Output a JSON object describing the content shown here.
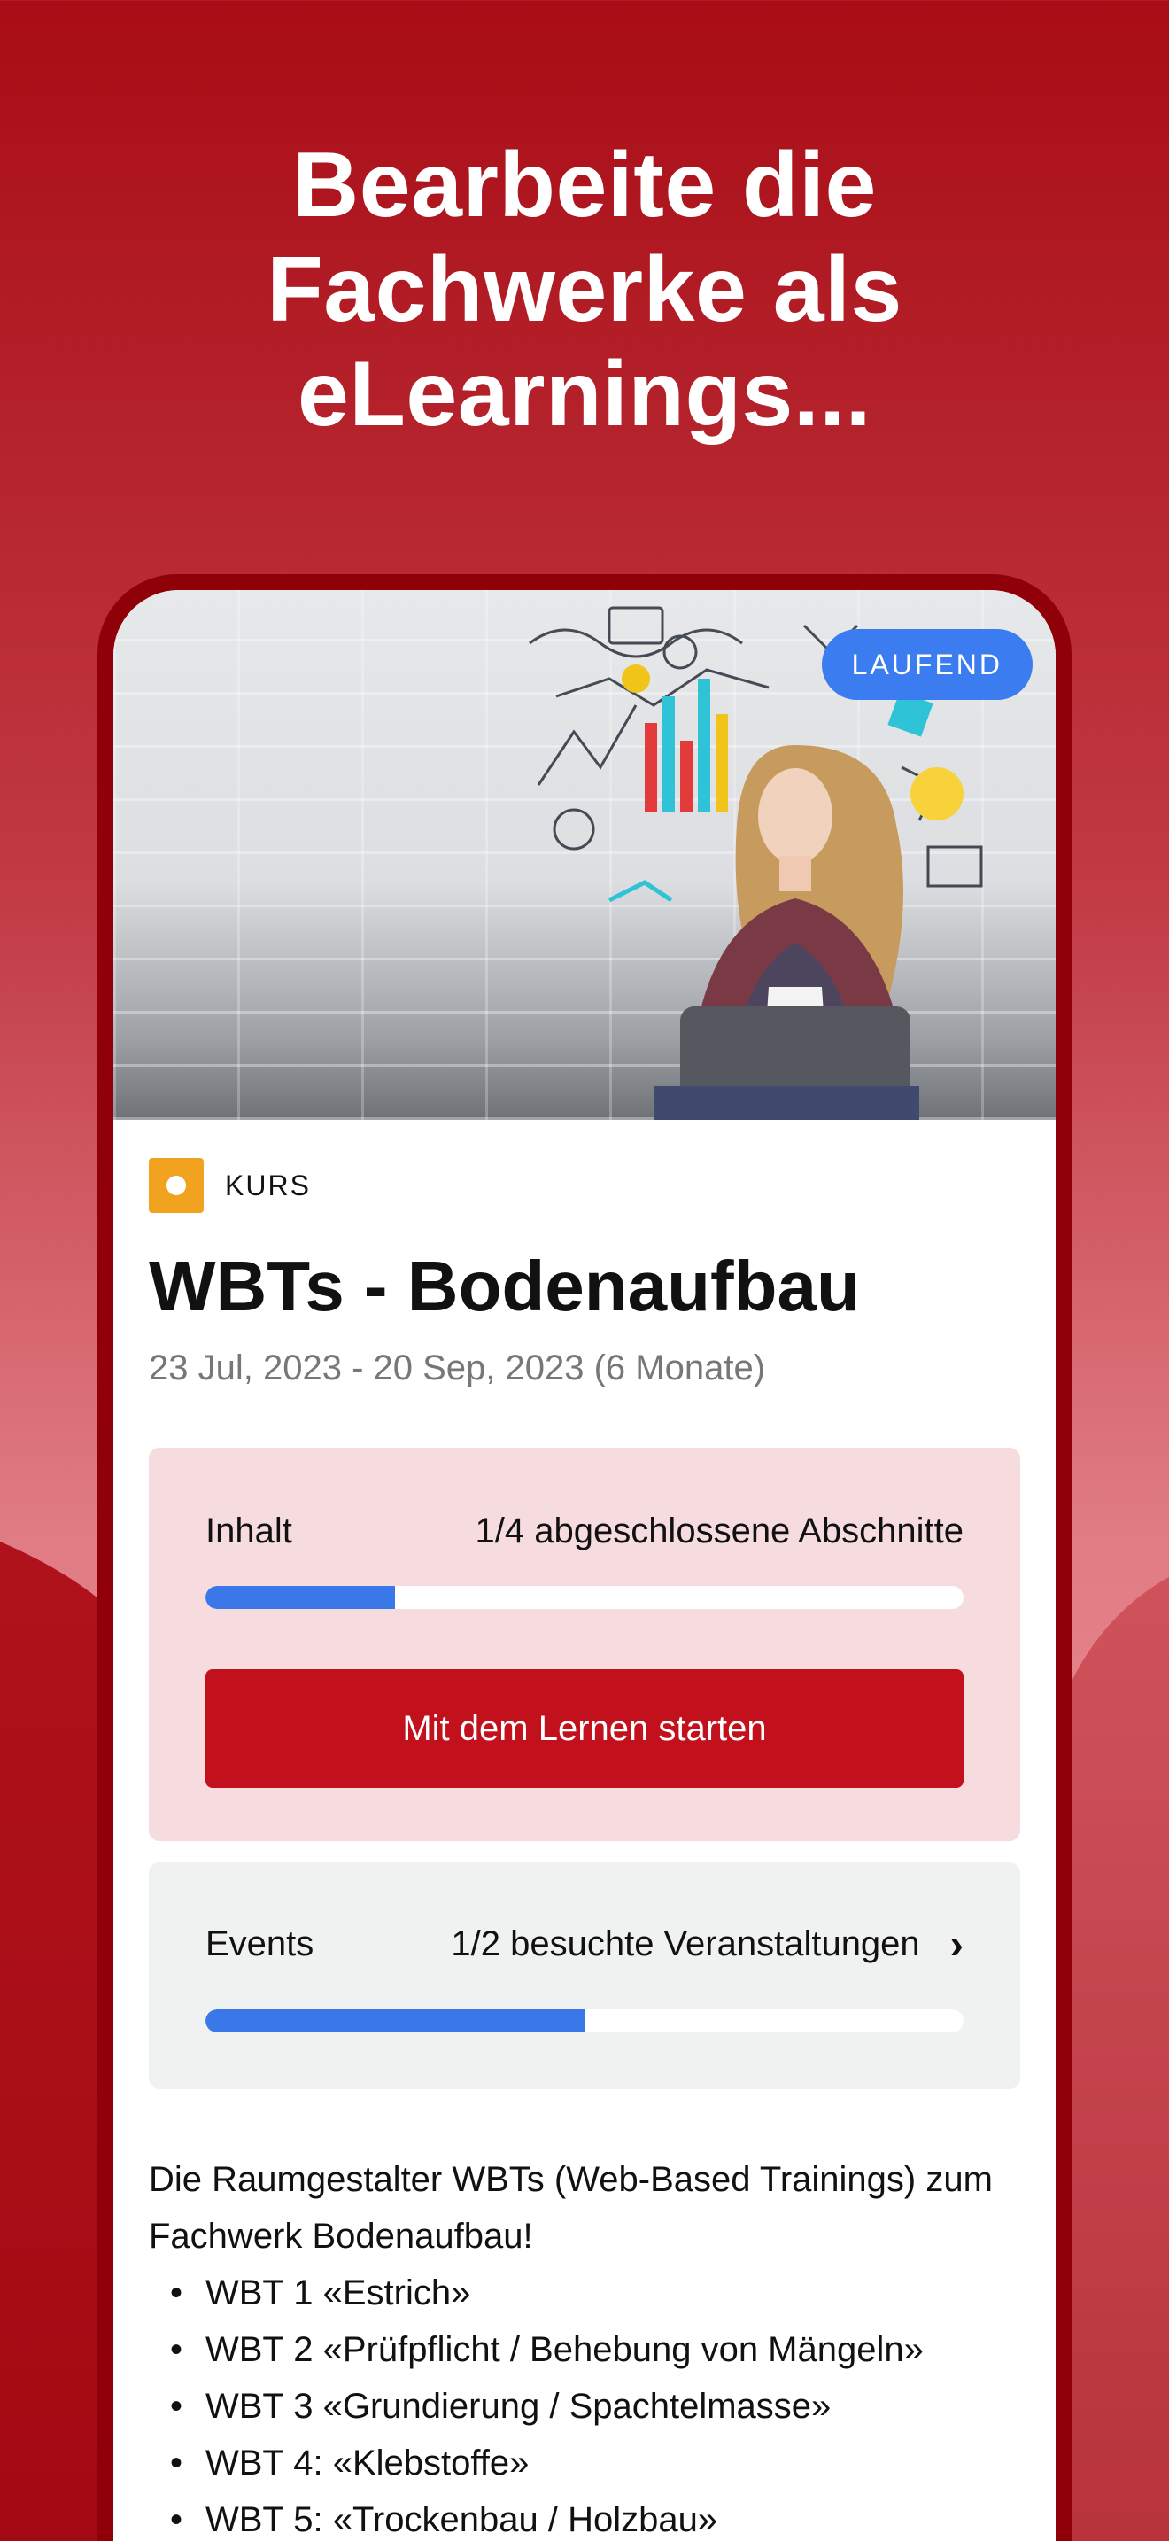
{
  "headline": {
    "line1": "Bearbeite die",
    "line2": "Fachwerke als",
    "line3": "eLearnings..."
  },
  "course": {
    "status_badge": "LAUFEND",
    "type_label": "KURS",
    "title": "WBTs - Bodenaufbau",
    "dates": "23 Jul, 2023 - 20 Sep, 2023 (6 Monate)"
  },
  "inhalt": {
    "label": "Inhalt",
    "value": "1/4 abgeschlossene Abschnitte",
    "progress": 0.25,
    "cta_label": "Mit dem Lernen starten"
  },
  "events": {
    "label": "Events",
    "value": "1/2 besuchte Veranstaltungen",
    "progress": 0.5,
    "chevron_icon": "chevron-right-icon"
  },
  "description": {
    "intro": "Die Raumgestalter WBTs (Web-Based Trainings) zum Fachwerk Bodenaufbau!",
    "items": [
      "WBT 1 «Estrich»",
      "WBT 2 «Prüfpflicht / Behebung von Mängeln»",
      "WBT 3 «Grundierung / Spachtelmasse»",
      "WBT 4: «Klebstoffe»",
      "WBT 5: «Trockenbau / Holzbau»"
    ]
  },
  "colors": {
    "brand_red": "#c2101c",
    "progress_blue": "#3a77e8",
    "badge_blue": "#3b7cf0",
    "course_type_orange": "#f1a21e"
  }
}
